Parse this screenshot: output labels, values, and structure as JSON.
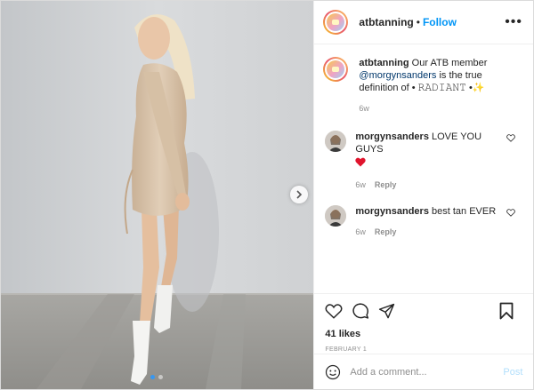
{
  "header": {
    "username": "atbtanning",
    "separator": "•",
    "follow_label": "Follow",
    "more_label": "•••"
  },
  "caption": {
    "username": "atbtanning",
    "text_before": " Our ATB member ",
    "mention": "@morgynsanders",
    "text_after": " is the true definition of • 𝚁𝙰𝙳𝙸𝙰𝙽𝚃 •",
    "emoji": "✨",
    "time": "6w"
  },
  "comments": [
    {
      "username": "morgynsanders",
      "text": "LOVE YOU GUYS",
      "emoji": "❤️",
      "time": "6w",
      "reply": "Reply"
    },
    {
      "username": "morgynsanders",
      "text": "best tan EVER",
      "time": "6w",
      "reply": "Reply"
    }
  ],
  "actions": {
    "likes": "41 likes",
    "date": "FEBRUARY 1"
  },
  "add_comment": {
    "placeholder": "Add a comment...",
    "post_label": "Post"
  },
  "carousel": {
    "current": 1,
    "total": 2
  },
  "colors": {
    "link": "#0095f6",
    "mention": "#00376b",
    "muted": "#8e8e8e",
    "heart": "#ed4956"
  }
}
